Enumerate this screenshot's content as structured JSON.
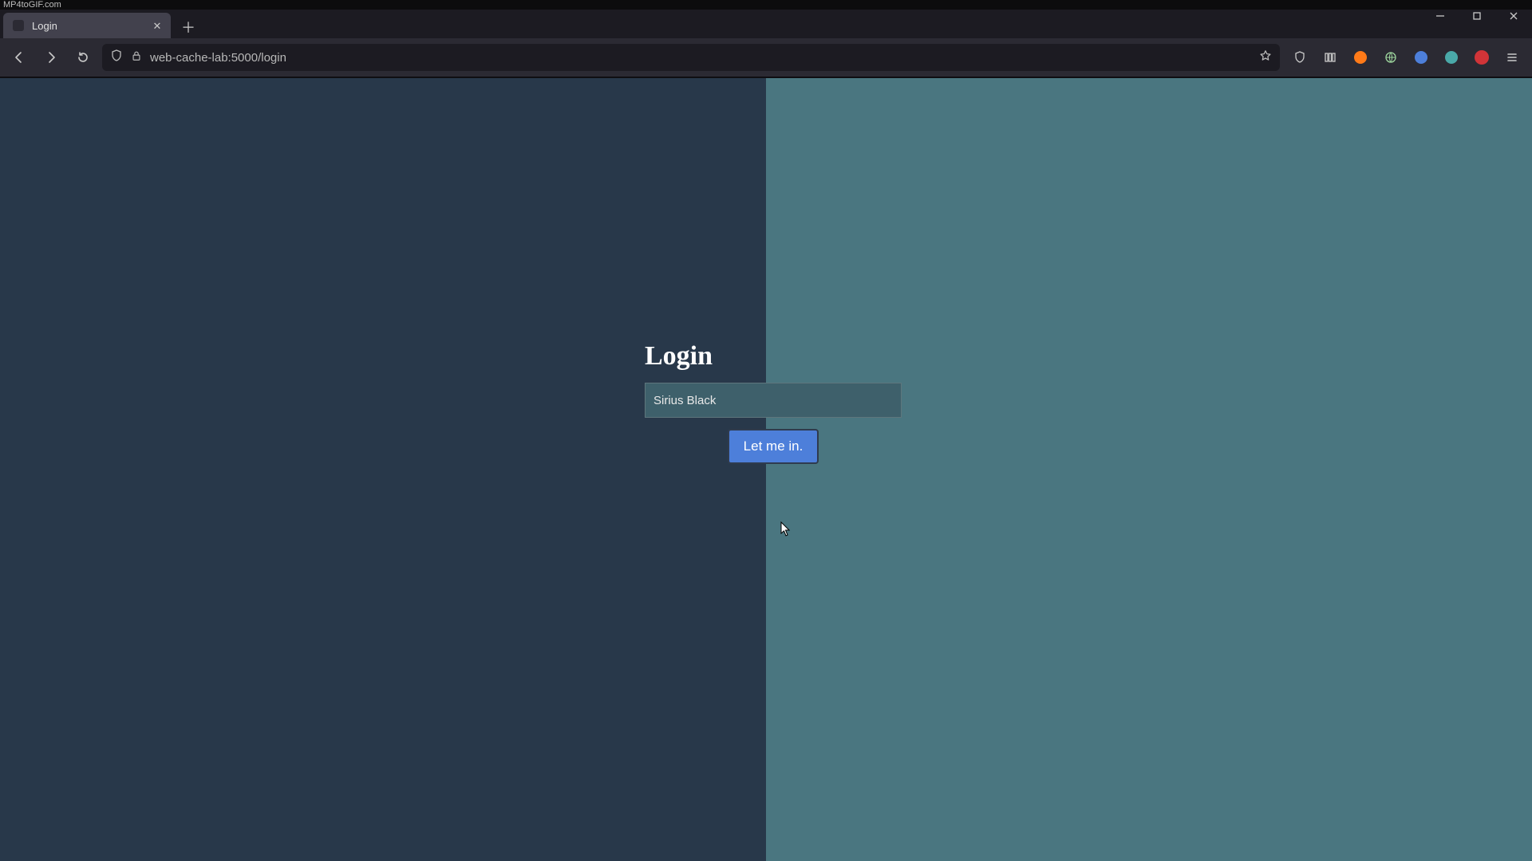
{
  "os_titlebar": {
    "text": "MP4toGIF.com"
  },
  "browser": {
    "tab_title": "Login",
    "url": "web-cache-lab:5000/login"
  },
  "page": {
    "heading": "Login",
    "name_value": "Sirius Black",
    "submit_label": "Let me in."
  }
}
